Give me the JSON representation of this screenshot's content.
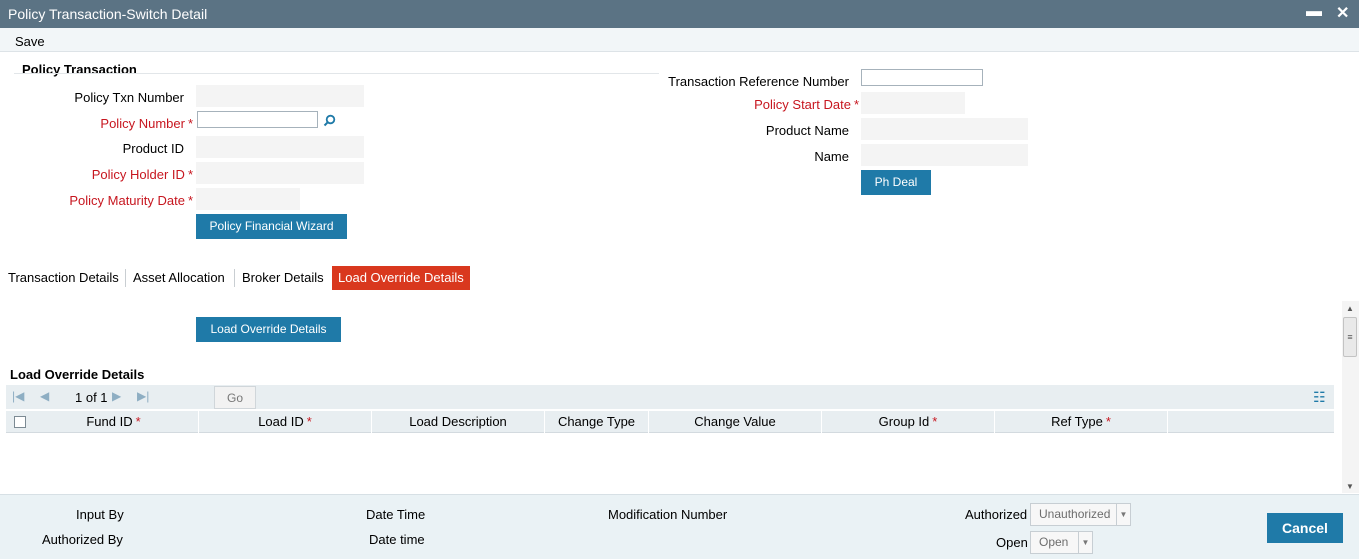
{
  "window": {
    "title": "Policy Transaction-Switch Detail",
    "minimize_glyph": "▬",
    "close_glyph": "✕"
  },
  "toolbar": {
    "save_label": "Save"
  },
  "policy_transaction": {
    "section_title": "Policy Transaction",
    "policy_txn_number_label": "Policy Txn Number",
    "policy_number_label": "Policy Number",
    "policy_number_value": "",
    "product_id_label": "Product ID",
    "policy_holder_id_label": "Policy Holder ID",
    "policy_maturity_date_label": "Policy Maturity Date",
    "policy_financial_wizard_label": "Policy Financial Wizard",
    "transaction_reference_number_label": "Transaction Reference Number",
    "transaction_reference_number_value": "",
    "policy_start_date_label": "Policy Start Date",
    "product_name_label": "Product Name",
    "name_label": "Name",
    "ph_deal_label": "Ph Deal",
    "required_mark": "*"
  },
  "tabs": [
    "Transaction Details",
    "Asset Allocation",
    "Broker Details",
    "Load Override Details"
  ],
  "active_tab": 3,
  "load_override": {
    "button_label": "Load Override Details",
    "grid_title": "Load Override Details",
    "pager_text": "1 of 1",
    "go_label": "Go",
    "columns": [
      "Fund ID",
      "Load ID",
      "Load Description",
      "Change Type",
      "Change Value",
      "Group Id",
      "Ref Type"
    ],
    "required_columns": [
      true,
      true,
      false,
      false,
      false,
      true,
      true
    ],
    "rows": []
  },
  "footer": {
    "input_by_label": "Input By",
    "authorized_by_label": "Authorized By",
    "date_time_label": "Date Time",
    "date_time_label_2": "Date time",
    "modification_number_label": "Modification Number",
    "authorized_label": "Authorized",
    "authorized_value": "Unauthorized",
    "open_label": "Open",
    "open_value": "Open",
    "cancel_label": "Cancel"
  },
  "colors": {
    "titlebar": "#5b7384",
    "accent": "#1f7aa8",
    "active_tab": "#d9381e",
    "required": "#c7161f"
  }
}
